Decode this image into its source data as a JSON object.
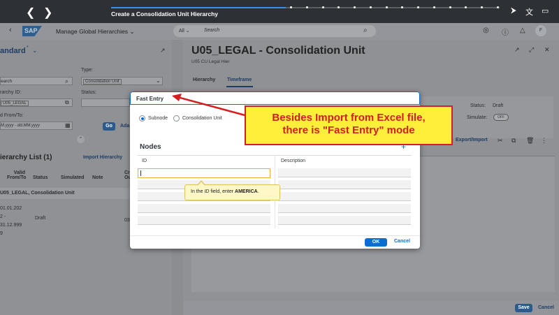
{
  "tutorial": {
    "title": "Create a Consolidation Unit Hierarchy",
    "progress_fraction": 0.45,
    "prev_icon": "chevron-left-icon",
    "next_icon": "chevron-right-icon"
  },
  "shell": {
    "logo": "SAP",
    "back": "‹",
    "app_title": "Manage Global Hierarchies ⌄",
    "search_scope": "All ⌄",
    "search_placeholder": "Search",
    "avatar": "F"
  },
  "left_panel": {
    "variant": "andard",
    "variant_mark": "*",
    "search_placeholder": "earch",
    "type_label": "Type:",
    "type_value": "Consolidation Unit",
    "hierarchy_id_label": "rarchy ID:",
    "hierarchy_id_value": "U05_LEGAL",
    "status_label": "Status:",
    "valid_label": "d From/To:",
    "valid_placeholder": "M.yyyy - dd.MM.yyyy",
    "go": "Go",
    "adapt": "Ada",
    "list_title": "ierarchy List (1)",
    "import_hierarchy": "Import Hierarchy",
    "columns": [
      "Valid From/To",
      "Status",
      "Simulated",
      "Note",
      "Cr Ou"
    ],
    "group_row": "U05_LEGAL, Consolidation Unit",
    "row": {
      "valid": "01.01.202 2 - 31.12.999 9",
      "status": "Draft",
      "created": "03"
    }
  },
  "object_page": {
    "title": "U05_LEGAL - Consolidation Unit",
    "subtitle": "U05 CU Legal Hier",
    "tabs": [
      "Hierarchy",
      "Timeframe"
    ],
    "status_label": "Status:",
    "status_value": "Draft",
    "simulate_label": "Simulate:",
    "simulate_value": "OFF",
    "export_import": "Export/Import",
    "save": "Save",
    "cancel": "Cancel"
  },
  "dialog": {
    "title": "Fast Entry",
    "radio_subnode": "Subnode",
    "radio_cu": "Consolidation Unit",
    "nodes_title": "Nodes",
    "col_id": "ID",
    "col_description": "Description",
    "tooltip_prefix": "In the ",
    "tooltip_field": "ID",
    "tooltip_mid": " field, enter ",
    "tooltip_value": "AMERICA",
    "tooltip_suffix": ".",
    "ok": "OK",
    "cancel": "Cancel"
  },
  "callout": {
    "line1": "Besides Import from Excel file,",
    "line2": "there is \"Fast Entry\" mode",
    "color_border": "#d41f1f",
    "color_fill": "#ffee3a"
  }
}
